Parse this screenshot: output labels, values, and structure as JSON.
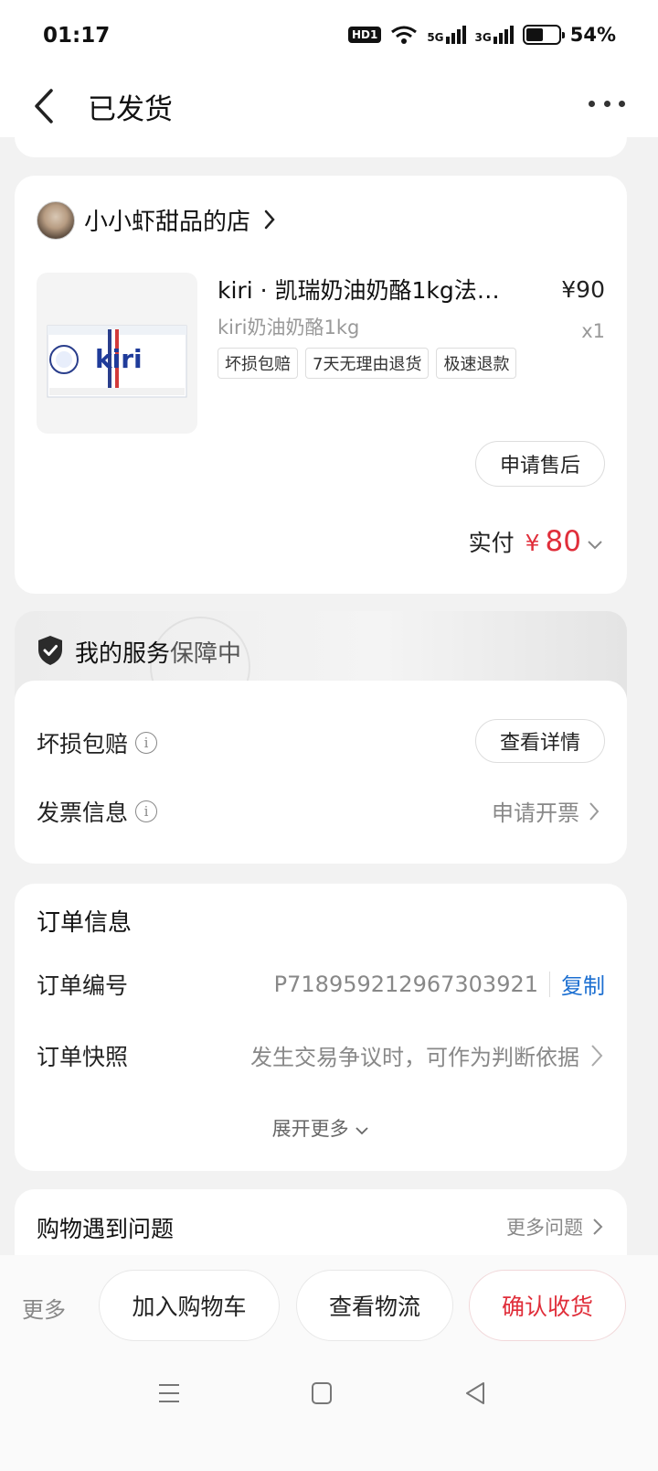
{
  "status_bar": {
    "time": "01:17",
    "hd": "HD1",
    "net1": "5G",
    "net2": "3G",
    "battery_percent": 54,
    "battery_label": "54%"
  },
  "nav": {
    "title": "已发货",
    "back_icon": "chevron-left-icon",
    "more_icon": "more-dots-icon"
  },
  "shop": {
    "name": "小小虾甜品的店",
    "product": {
      "title": "kiri · 凯瑞奶油奶酪1kg法…",
      "price": "¥90",
      "spec": "kiri奶油奶酪1kg",
      "quantity": "x1",
      "image_brand": "kiri",
      "tags": [
        "坏损包赔",
        "7天无理由退货",
        "极速退款"
      ]
    },
    "after_sale_button": "申请售后",
    "paid_label": "实付",
    "paid_currency": "¥",
    "paid_amount": "80"
  },
  "service": {
    "title_main": "我的服务",
    "title_sub": "保障中",
    "damage_label": "坏损包赔",
    "detail_button": "查看详情",
    "invoice_label": "发票信息",
    "invoice_action": "申请开票"
  },
  "order": {
    "heading": "订单信息",
    "number_label": "订单编号",
    "number_value": "P718959212967303921",
    "copy_label": "复制",
    "snapshot_label": "订单快照",
    "snapshot_value": "发生交易争议时，可作为判断依据",
    "expand_label": "展开更多"
  },
  "problem": {
    "label": "购物遇到问题",
    "more": "更多问题"
  },
  "bottom": {
    "more": "更多",
    "add_cart": "加入购物车",
    "logistics": "查看物流",
    "confirm": "确认收货"
  },
  "colors": {
    "accent_red": "#e02e3a",
    "link_blue": "#1c6fd1"
  }
}
